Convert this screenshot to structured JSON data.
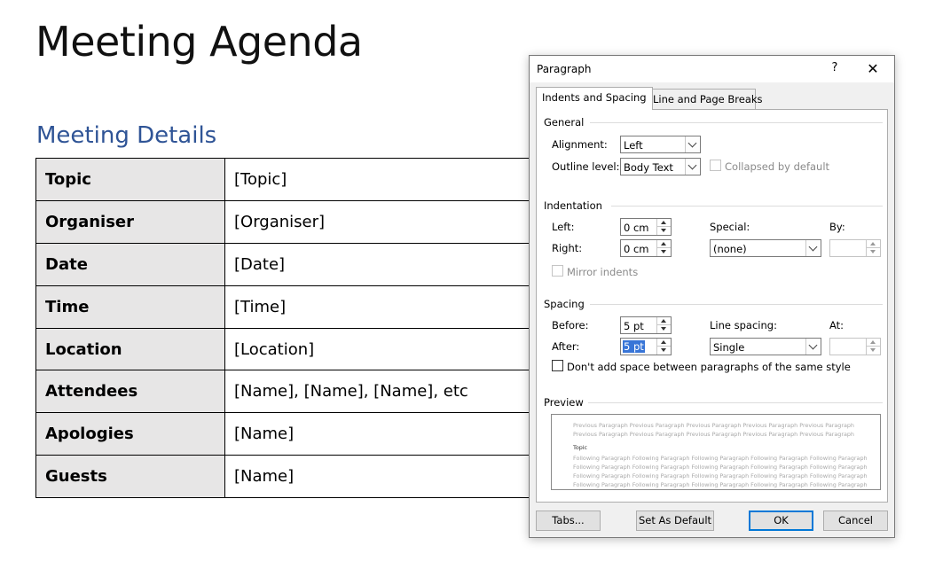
{
  "document": {
    "title": "Meeting Agenda",
    "heading": "Meeting Details",
    "rows": [
      {
        "label": "Topic",
        "value": "[Topic]"
      },
      {
        "label": "Organiser",
        "value": "[Organiser]"
      },
      {
        "label": "Date",
        "value": "[Date]"
      },
      {
        "label": "Time",
        "value": "[Time]"
      },
      {
        "label": "Location",
        "value": "[Location]"
      },
      {
        "label": "Attendees",
        "value": "[Name], [Name], [Name], etc"
      },
      {
        "label": "Apologies",
        "value": "[Name]"
      },
      {
        "label": "Guests",
        "value": "[Name]"
      }
    ]
  },
  "dialog": {
    "title": "Paragraph",
    "help": "?",
    "close": "✕",
    "tabs": [
      "Indents and Spacing",
      "Line and Page Breaks"
    ],
    "general": {
      "section": "General",
      "alignment_label": "Alignment:",
      "alignment_value": "Left",
      "outline_label": "Outline level:",
      "outline_value": "Body Text",
      "collapsed_label": "Collapsed by default"
    },
    "indentation": {
      "section": "Indentation",
      "left_label": "Left:",
      "left_value": "0 cm",
      "right_label": "Right:",
      "right_value": "0 cm",
      "special_label": "Special:",
      "special_value": "(none)",
      "by_label": "By:",
      "by_value": "",
      "mirror_label": "Mirror indents"
    },
    "spacing": {
      "section": "Spacing",
      "before_label": "Before:",
      "before_value": "5 pt",
      "after_label": "After:",
      "after_value": "5 pt",
      "line_spacing_label": "Line spacing:",
      "line_spacing_value": "Single",
      "at_label": "At:",
      "at_value": "",
      "dont_add_label": "Don't add space between paragraphs of the same style"
    },
    "preview": {
      "section": "Preview",
      "previous_lines": [
        "Previous Paragraph Previous Paragraph Previous Paragraph Previous Paragraph Previous Paragraph",
        "Previous Paragraph Previous Paragraph Previous Paragraph Previous Paragraph Previous Paragraph"
      ],
      "sample": "Topic",
      "following_lines": [
        "Following Paragraph Following Paragraph Following Paragraph Following Paragraph Following Paragraph",
        "Following Paragraph Following Paragraph Following Paragraph Following Paragraph Following Paragraph",
        "Following Paragraph Following Paragraph Following Paragraph Following Paragraph Following Paragraph",
        "Following Paragraph Following Paragraph Following Paragraph Following Paragraph Following Paragraph"
      ]
    },
    "buttons": {
      "tabs": "Tabs...",
      "set_default": "Set As Default",
      "ok": "OK",
      "cancel": "Cancel"
    }
  }
}
